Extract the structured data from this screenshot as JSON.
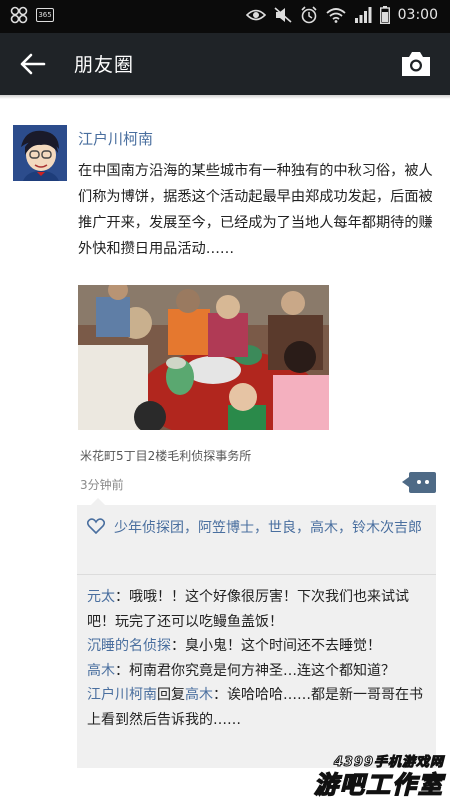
{
  "statusbar": {
    "time": "03:00",
    "badge": "365"
  },
  "titlebar": {
    "title": "朋友圈"
  },
  "post": {
    "author": "江户川柯南",
    "text": "在中国南方沿海的某些城市有一种独有的中秋习俗，被人们称为博饼，据悉这个活动起最早由郑成功发起，后面被推广开来，发展至今，已经成为了当地人每年都期待的赚外快和攒日用品活动……",
    "location": "米花町5丁目2楼毛利侦探事务所",
    "time": "3分钟前"
  },
  "likes": {
    "names": "少年侦探团，阿笠博士，世良，高木，铃木次吉郎"
  },
  "comments": [
    {
      "name": "元太",
      "sep": "：",
      "text": "哦哦！！这个好像很厉害！下次我们也来试试吧！玩完了还可以吃鳗鱼盖饭！"
    },
    {
      "name": "沉睡的名侦探",
      "sep": "：",
      "text": "臭小鬼！这个时间还不去睡觉！"
    },
    {
      "name": "高木",
      "sep": "：",
      "text": "柯南君你究竟是何方神圣…连这个都知道？"
    },
    {
      "name": "江户川柯南",
      "reply": "回复",
      "target": "高木",
      "sep": "：",
      "text": "诶哈哈哈……都是新一哥哥在书上看到然后告诉我的……"
    }
  ],
  "watermark": {
    "top": "4399手机游戏网",
    "bottom": "游吧工作室"
  },
  "colors": {
    "name_blue": "#4a6f9f",
    "titlebar_bg": "#1f2327",
    "comment_panel": "#f0f0f0"
  }
}
